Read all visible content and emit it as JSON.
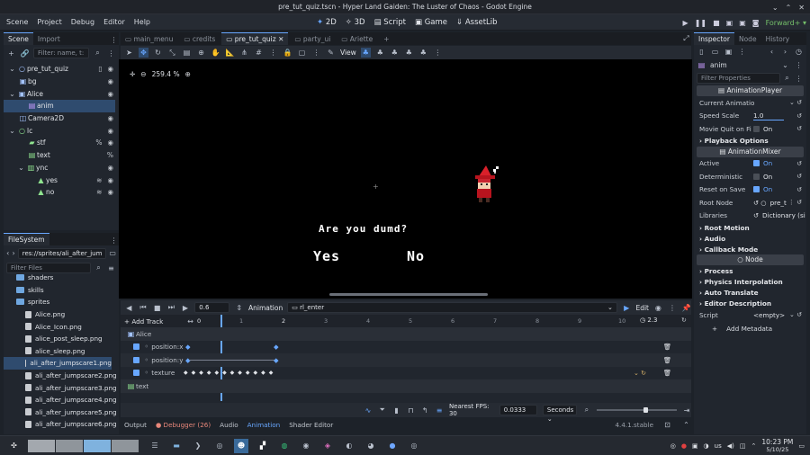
{
  "window": {
    "title": "pre_tut_quiz.tscn - Hyper Land Gaiden: The Luster of Chaos - Godot Engine"
  },
  "menu": [
    "Scene",
    "Project",
    "Debug",
    "Editor",
    "Help"
  ],
  "modes": [
    {
      "label": "2D",
      "active": true
    },
    {
      "label": "3D"
    },
    {
      "label": "Script"
    },
    {
      "label": "Game"
    },
    {
      "label": "AssetLib"
    }
  ],
  "renderer": "Forward+",
  "scene_dock": {
    "tabs": [
      "Scene",
      "Import"
    ],
    "filter_placeholder": "Filter: name, t:",
    "nodes": [
      {
        "label": "pre_tut_quiz",
        "indent": 0,
        "icon": "node2d-icon"
      },
      {
        "label": "bg",
        "indent": 1,
        "icon": "sprite-icon"
      },
      {
        "label": "Alice",
        "indent": 1,
        "icon": "sprite-icon"
      },
      {
        "label": "anim",
        "indent": 2,
        "icon": "animation-player-icon",
        "selected": true
      },
      {
        "label": "Camera2D",
        "indent": 1,
        "icon": "camera-icon"
      },
      {
        "label": "lc",
        "indent": 1,
        "icon": "control-icon"
      },
      {
        "label": "stf",
        "indent": 2,
        "icon": "label-icon"
      },
      {
        "label": "text",
        "indent": 2,
        "icon": "label-icon"
      },
      {
        "label": "ync",
        "indent": 2,
        "icon": "container-icon"
      },
      {
        "label": "yes",
        "indent": 3,
        "icon": "label-icon"
      },
      {
        "label": "no",
        "indent": 3,
        "icon": "label-icon"
      }
    ]
  },
  "filesystem": {
    "title": "FileSystem",
    "path": "res://sprites/ali_after_jum",
    "filter_placeholder": "Filter Files",
    "items": [
      {
        "label": "shaders",
        "type": "folder"
      },
      {
        "label": "skills",
        "type": "folder"
      },
      {
        "label": "sprites",
        "type": "folder"
      },
      {
        "label": "Alice.png",
        "type": "file"
      },
      {
        "label": "Alice_Icon.png",
        "type": "file"
      },
      {
        "label": "alice_post_sleep.png",
        "type": "file"
      },
      {
        "label": "alice_sleep.png",
        "type": "file"
      },
      {
        "label": "ali_after_jumpscare1.png",
        "type": "file",
        "selected": true
      },
      {
        "label": "ali_after_jumpscare2.png",
        "type": "file"
      },
      {
        "label": "ali_after_jumpscare3.png",
        "type": "file"
      },
      {
        "label": "ali_after_jumpscare4.png",
        "type": "file"
      },
      {
        "label": "ali_after_jumpscare5.png",
        "type": "file"
      },
      {
        "label": "ali_after_jumpscare6.png",
        "type": "file"
      }
    ]
  },
  "editor_tabs": [
    "main_menu",
    "credits",
    "pre_tut_quiz",
    "party_ui",
    "Ariette"
  ],
  "viewport": {
    "zoom": "259.4 %",
    "view_label": "View",
    "dialog": "Are you dumd?",
    "yes": "Yes",
    "no": "No"
  },
  "inspector": {
    "tabs": [
      "Inspector",
      "Node",
      "History"
    ],
    "object": "anim",
    "filter_placeholder": "Filter Properties",
    "class_player": "AnimationPlayer",
    "current_animation": "Current Animatio",
    "speed_scale_label": "Speed Scale",
    "speed_scale": "1.0",
    "movie_quit_label": "Movie Quit on Fi",
    "on": "On",
    "playback_options": "Playback Options",
    "class_mixer": "AnimationMixer",
    "active_label": "Active",
    "deterministic_label": "Deterministic",
    "reset_label": "Reset on Save",
    "root_node_label": "Root Node",
    "root_node": "pre_t",
    "libraries_label": "Libraries",
    "libraries": "Dictionary (si",
    "root_motion": "Root Motion",
    "audio": "Audio",
    "callback_mode": "Callback Mode",
    "node_head": "Node",
    "process": "Process",
    "physics_interp": "Physics Interpolation",
    "auto_translate": "Auto Translate",
    "editor_description": "Editor Description",
    "script_label": "Script",
    "script_value": "<empty>",
    "add_metadata": "Add Metadata"
  },
  "animation": {
    "time": "0.6",
    "animation_btn": "Animation",
    "anim_name": "rl_enter",
    "edit": "Edit",
    "add_track": "Add Track",
    "ruler": [
      "0",
      "1",
      "2",
      "3",
      "4",
      "5",
      "6",
      "7",
      "8",
      "9",
      "10"
    ],
    "length": "2.3",
    "tracks": [
      {
        "label": "Alice",
        "type": "group"
      },
      {
        "label": "position:x",
        "type": "track"
      },
      {
        "label": "position:y",
        "type": "track"
      },
      {
        "label": "texture",
        "type": "track"
      },
      {
        "label": "text",
        "type": "group"
      }
    ],
    "fps_label": "Nearest FPS: 30",
    "step": "0.0333",
    "unit": "Seconds"
  },
  "bottom_tabs": [
    "Output",
    "Debugger (26)",
    "Audio",
    "Animation",
    "Shader Editor"
  ],
  "version": "4.4.1.stable",
  "taskbar": {
    "time": "10:23 PM",
    "date": "5/10/25",
    "lang": "us"
  }
}
